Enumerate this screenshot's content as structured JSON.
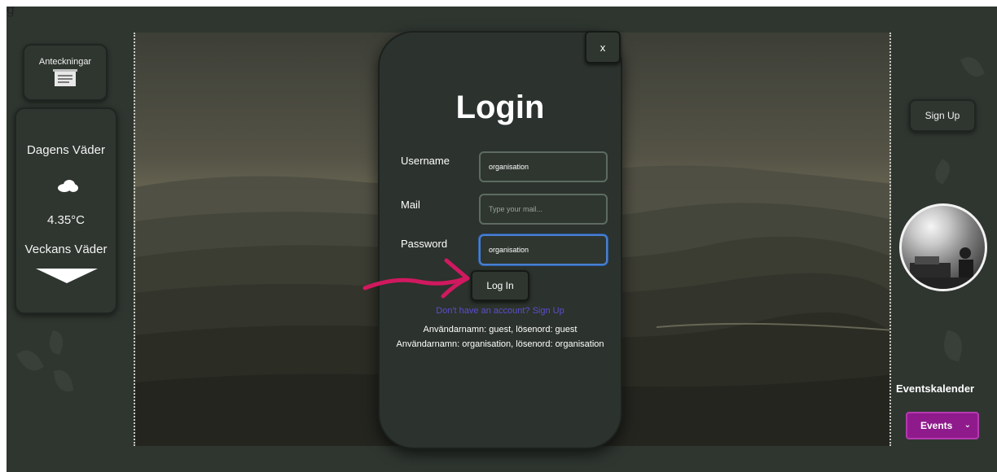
{
  "corner_glyph": "g",
  "left_panel": {
    "notes_label": "Anteckningar",
    "weather": {
      "title": "Dagens Väder",
      "icon": "cloud-icon",
      "temperature": "4.35°C",
      "week_title": "Veckans Väder",
      "expand_icon": "triangle-down-icon"
    }
  },
  "modal": {
    "close_label": "x",
    "title": "Login",
    "fields": {
      "username_label": "Username",
      "username_value": "organisation",
      "mail_label": "Mail",
      "mail_placeholder": "Type your mail...",
      "password_label": "Password",
      "password_value": "organisation"
    },
    "login_button": "Log In",
    "signup_link": "Don't have an account? Sign Up",
    "credentials": {
      "line1": "Användarnamn: guest, lösenord: guest",
      "line2": "Användarnamn: organisation, lösenord: organisation"
    }
  },
  "right_panel": {
    "signup_button": "Sign Up",
    "events_title": "Eventskalender",
    "events_button": "Events",
    "events_caret": "⌄"
  },
  "colors": {
    "background": "#2f3630",
    "events_accent": "#8f1a8b",
    "link": "#5a4fd1",
    "annotation_arrow": "#d0195f",
    "focus_border": "#4a7fd0"
  }
}
